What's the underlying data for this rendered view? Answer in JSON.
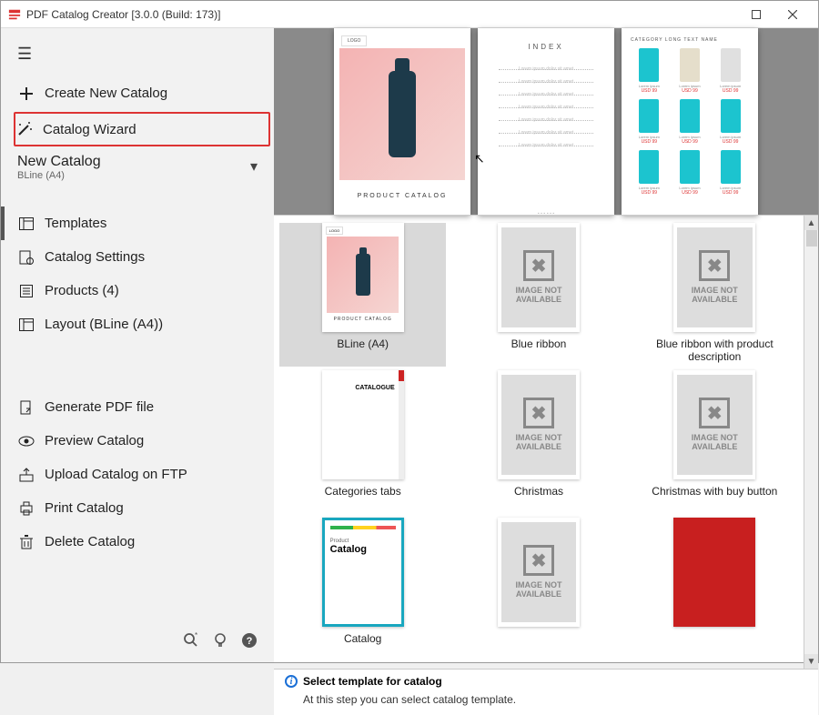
{
  "window": {
    "title": "PDF Catalog Creator [3.0.0 (Build: 173)]"
  },
  "sidebar": {
    "create": "Create New Catalog",
    "wizard": "Catalog Wizard",
    "catalog": {
      "name": "New Catalog",
      "sub": "BLine (A4)"
    },
    "templates": "Templates",
    "settings": "Catalog Settings",
    "products": "Products (4)",
    "layout": "Layout (BLine (A4))",
    "generate": "Generate PDF file",
    "preview": "Preview Catalog",
    "upload": "Upload Catalog on FTP",
    "print": "Print Catalog",
    "delete": "Delete Catalog"
  },
  "preview": {
    "cover_tag": "LOGO",
    "cover_caption": "PRODUCT CATALOG",
    "index_title": "INDEX",
    "grid_title": "CATEGORY LONG TEXT NAME"
  },
  "templates": [
    {
      "label": "BLine (A4)",
      "kind": "cover",
      "selected": true
    },
    {
      "label": "Blue ribbon",
      "kind": "placeholder"
    },
    {
      "label": "Blue ribbon with product description",
      "kind": "placeholder"
    },
    {
      "label": "Categories tabs",
      "kind": "cattabs"
    },
    {
      "label": "Christmas",
      "kind": "placeholder"
    },
    {
      "label": "Christmas with buy button",
      "kind": "placeholder"
    },
    {
      "label": "Catalog",
      "kind": "colorful"
    },
    {
      "label": "",
      "kind": "placeholder"
    },
    {
      "label": "",
      "kind": "red"
    }
  ],
  "placeholder": {
    "line1": "IMAGE NOT",
    "line2": "AVAILABLE"
  },
  "colorful": {
    "small": "Product",
    "big": "Catalog"
  },
  "cattabs": {
    "t1": "CATALOGUE",
    "t2": ""
  },
  "status": {
    "title": "Select template for catalog",
    "desc": "At this step you can select catalog template."
  }
}
